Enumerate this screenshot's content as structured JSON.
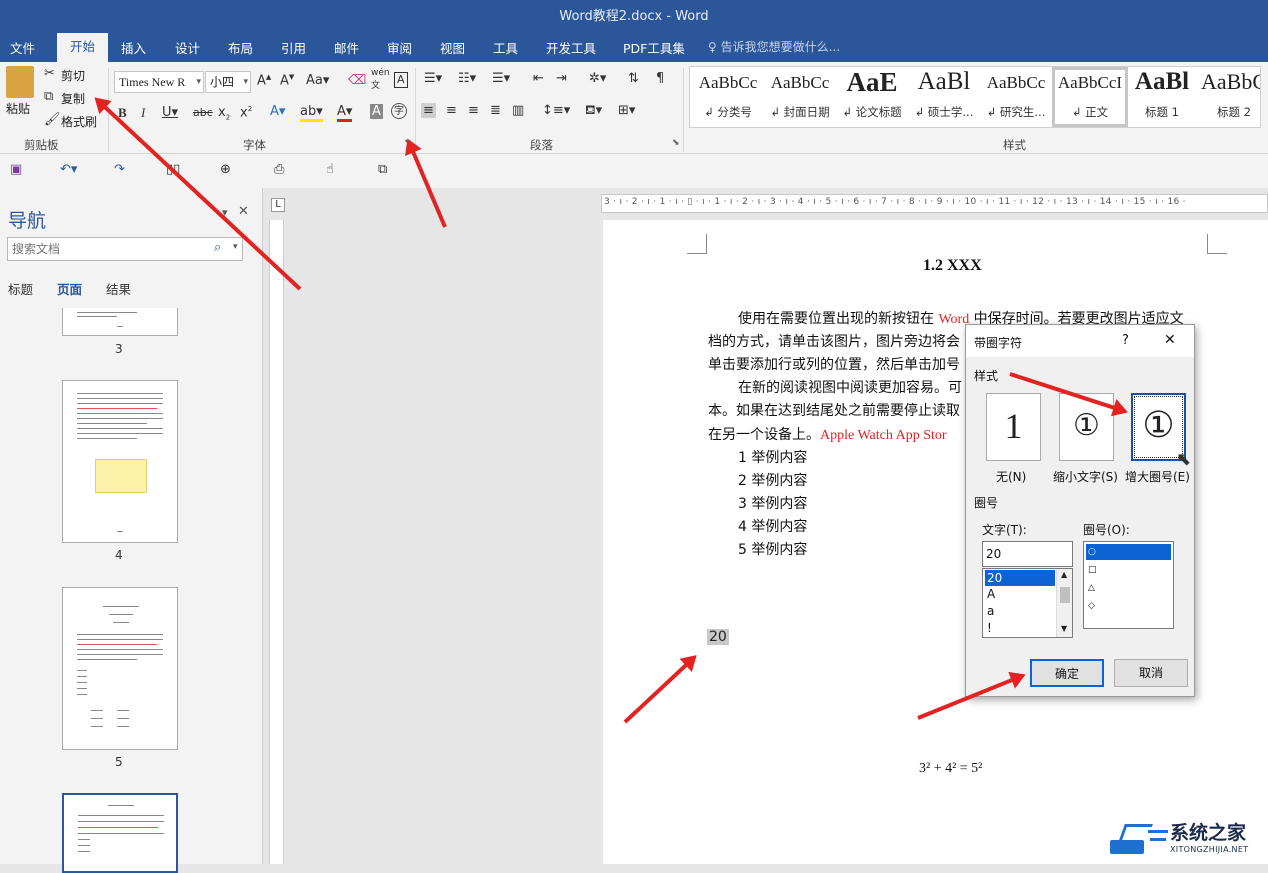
{
  "window": {
    "title": "Word教程2.docx - Word"
  },
  "tabs": [
    "文件",
    "开始",
    "插入",
    "设计",
    "布局",
    "引用",
    "邮件",
    "审阅",
    "视图",
    "工具",
    "开发工具",
    "PDF工具集"
  ],
  "tell_me": "告诉我您想要做什么...",
  "clipboard": {
    "paste": "粘贴",
    "cut": "剪切",
    "copy": "复制",
    "format_painter": "格式刷",
    "label": "剪贴板"
  },
  "font": {
    "name": "Times New R",
    "size": "小四",
    "label": "字体",
    "wen_label": "wén",
    "wen_char": "文"
  },
  "paragraph": {
    "label": "段落"
  },
  "styles": {
    "label": "样式",
    "items": [
      {
        "sample": "AaBbCc",
        "name": "↲ 分类号"
      },
      {
        "sample": "AaBbCc",
        "name": "↲ 封面日期"
      },
      {
        "sample": "AaE",
        "name": "↲ 论文标题"
      },
      {
        "sample": "AaBl",
        "name": "↲ 硕士学..."
      },
      {
        "sample": "AaBbCc",
        "name": "↲ 研究生..."
      },
      {
        "sample": "AaBbCcI",
        "name": "↲ 正文"
      },
      {
        "sample": "AaBl",
        "name": "标题 1"
      },
      {
        "sample": "AaBbC",
        "name": "标题 2"
      }
    ]
  },
  "nav": {
    "title": "导航",
    "search_placeholder": "搜索文档",
    "tabs": [
      "标题",
      "页面",
      "结果"
    ],
    "page_numbers": [
      "3",
      "4",
      "5"
    ]
  },
  "ruler": {
    "ticks": "3 · ı · 2 · ı · 1 · ı · ▯ · ı · 1 · ı · 2 · ı · 3 · ı · 4 · ı · 5 · ı · 6 · ı · 7 · ı · 8 · ı · 9 · ı · 10 · ı · 11 · ı · 12 · ı · 13 · ı · 14 · ı · 15 · ı · 16 ·"
  },
  "document": {
    "heading": "1.2 XXX",
    "p1_a": "使用在需要位置出现的新按钮在",
    "p1_word": "Word",
    "p1_b": "中保存时间。若要更改图片适应文",
    "p1_line2": "档的方式，请单击该图片，图片旁边将会",
    "p1_line3": "单击要添加行或列的位置，然后单击加号",
    "p2_line1": "在新的阅读视图中阅读更加容易。可",
    "p2_line2": "本。如果在达到结尾处之前需要停止读取",
    "p2_line3a": "在另一个设备上。",
    "p2_line3_red": "Apple Watch    App Stor",
    "list": [
      "1 举例内容",
      "2 举例内容",
      "3 举例内容",
      "4 举例内容",
      "5 举例内容"
    ],
    "selected_text": "20",
    "equation": "3² + 4² = 5²"
  },
  "dialog": {
    "title": "带圈字符",
    "help": "?",
    "close": "✕",
    "style_label": "样式",
    "options": [
      {
        "glyph": "1",
        "label": "无(N)"
      },
      {
        "glyph": "①",
        "label": "缩小文字(S)"
      },
      {
        "glyph": "①",
        "label": "增大圈号(E)"
      }
    ],
    "circle_section": "圈号",
    "text_label": "文字(T):",
    "circle_label": "圈号(O):",
    "text_value": "20",
    "text_options": [
      "20",
      "A",
      "a",
      "!"
    ],
    "circle_options": [
      "○",
      "□",
      "△",
      "◇"
    ],
    "ok": "确定",
    "cancel": "取消"
  },
  "watermark": {
    "name": "系统之家",
    "url": "XITONGZHIJIA.NET"
  }
}
